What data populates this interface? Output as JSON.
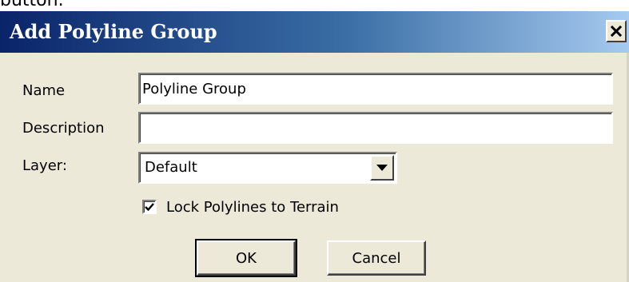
{
  "cropped_caption": "button.",
  "window": {
    "title": "Add Polyline Group",
    "close_icon": "close-icon"
  },
  "form": {
    "name_label": "Name",
    "name_value": "Polyline Group",
    "description_label": "Description",
    "description_value": "",
    "layer_label": "Layer:",
    "layer_value": "Default",
    "lock_label": "Lock Polylines to Terrain",
    "lock_checked": true
  },
  "buttons": {
    "ok_label": "OK",
    "cancel_label": "Cancel"
  },
  "colors": {
    "title_bar_start": "#0a246a",
    "title_bar_end": "#a6caf0",
    "dialog_background": "#ece9d8"
  }
}
